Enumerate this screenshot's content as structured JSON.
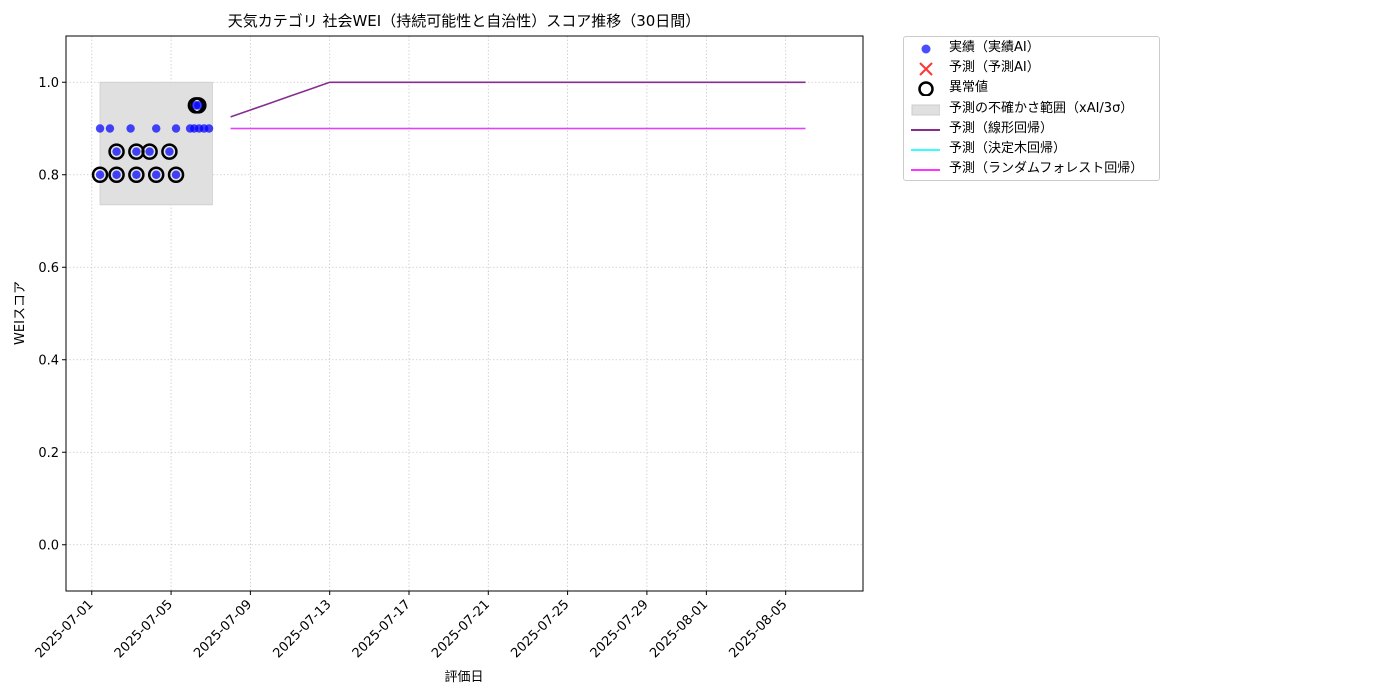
{
  "chart_data": {
    "type": "scatter",
    "title": "天気カテゴリ 社会WEI（持続可能性と自治性）スコア推移（30日間）",
    "xlabel": "評価日",
    "ylabel": "WEIスコア",
    "xlim": [
      "2025-06-29.7",
      "2025-08-08.9"
    ],
    "ylim": [
      -0.1,
      1.1
    ],
    "yticks": [
      0.0,
      0.2,
      0.4,
      0.6,
      0.8,
      1.0
    ],
    "ytick_labels": [
      "0.0",
      "0.2",
      "0.4",
      "0.6",
      "0.8",
      "1.0"
    ],
    "xticks": [
      "2025-07-01",
      "2025-07-05",
      "2025-07-09",
      "2025-07-13",
      "2025-07-17",
      "2025-07-21",
      "2025-07-25",
      "2025-07-29",
      "2025-08-01",
      "2025-08-05"
    ],
    "grid": true,
    "legend_position": "outside-top-right",
    "series": [
      {
        "name": "実績（実績AI）",
        "kind": "scatter",
        "color": "#0000ff",
        "points": [
          {
            "x": "2025-07-01 10:00",
            "y": 0.8
          },
          {
            "x": "2025-07-01 10:00",
            "y": 0.9
          },
          {
            "x": "2025-07-01 22:00",
            "y": 0.9
          },
          {
            "x": "2025-07-02 06:00",
            "y": 0.8
          },
          {
            "x": "2025-07-02 06:00",
            "y": 0.85
          },
          {
            "x": "2025-07-02 23:00",
            "y": 0.9
          },
          {
            "x": "2025-07-03 06:00",
            "y": 0.8
          },
          {
            "x": "2025-07-03 06:00",
            "y": 0.85
          },
          {
            "x": "2025-07-03 22:00",
            "y": 0.85
          },
          {
            "x": "2025-07-04 06:00",
            "y": 0.8
          },
          {
            "x": "2025-07-04 06:00",
            "y": 0.9
          },
          {
            "x": "2025-07-04 22:00",
            "y": 0.85
          },
          {
            "x": "2025-07-05 06:00",
            "y": 0.8
          },
          {
            "x": "2025-07-05 06:00",
            "y": 0.9
          },
          {
            "x": "2025-07-05 23:00",
            "y": 0.9
          },
          {
            "x": "2025-07-06 04:00",
            "y": 0.9
          },
          {
            "x": "2025-07-06 06:00",
            "y": 0.95
          },
          {
            "x": "2025-07-06 09:00",
            "y": 0.95
          },
          {
            "x": "2025-07-06 10:00",
            "y": 0.9
          },
          {
            "x": "2025-07-06 16:00",
            "y": 0.9
          },
          {
            "x": "2025-07-06 22:00",
            "y": 0.9
          }
        ]
      },
      {
        "name": "予測（予測AI）",
        "kind": "scatter",
        "color": "#ff3333",
        "points": []
      },
      {
        "name": "異常値",
        "kind": "ring",
        "color": "#000000",
        "points": [
          {
            "x": "2025-07-01 10:00",
            "y": 0.8
          },
          {
            "x": "2025-07-02 06:00",
            "y": 0.8
          },
          {
            "x": "2025-07-02 06:00",
            "y": 0.85
          },
          {
            "x": "2025-07-03 06:00",
            "y": 0.8
          },
          {
            "x": "2025-07-03 06:00",
            "y": 0.85
          },
          {
            "x": "2025-07-03 22:00",
            "y": 0.85
          },
          {
            "x": "2025-07-04 06:00",
            "y": 0.8
          },
          {
            "x": "2025-07-04 22:00",
            "y": 0.85
          },
          {
            "x": "2025-07-05 06:00",
            "y": 0.8
          },
          {
            "x": "2025-07-06 06:00",
            "y": 0.95
          },
          {
            "x": "2025-07-06 09:00",
            "y": 0.95
          }
        ]
      },
      {
        "name": "予測の不確かさ範囲（xAI/3σ）",
        "kind": "band",
        "color": "#e0e0e0",
        "x": [
          "2025-07-01 10:00",
          "2025-07-07 02:00"
        ],
        "y": [
          0.735,
          1.0
        ]
      },
      {
        "name": "予測（線形回帰）",
        "kind": "line",
        "color": "#882d90",
        "points": [
          {
            "x": "2025-07-08",
            "y": 0.925
          },
          {
            "x": "2025-07-09",
            "y": 0.94
          },
          {
            "x": "2025-07-10",
            "y": 0.955
          },
          {
            "x": "2025-07-11",
            "y": 0.97
          },
          {
            "x": "2025-07-12",
            "y": 0.985
          },
          {
            "x": "2025-07-13",
            "y": 1.0
          },
          {
            "x": "2025-08-06",
            "y": 1.0
          }
        ]
      },
      {
        "name": "予測（決定木回帰）",
        "kind": "line",
        "color": "#33ffff",
        "points": [
          {
            "x": "2025-07-08",
            "y": 0.9
          },
          {
            "x": "2025-08-06",
            "y": 0.9
          }
        ]
      },
      {
        "name": "予測（ランダムフォレスト回帰）",
        "kind": "line",
        "color": "#ff33ff",
        "points": [
          {
            "x": "2025-07-08",
            "y": 0.9
          },
          {
            "x": "2025-08-06",
            "y": 0.9
          }
        ]
      }
    ]
  }
}
